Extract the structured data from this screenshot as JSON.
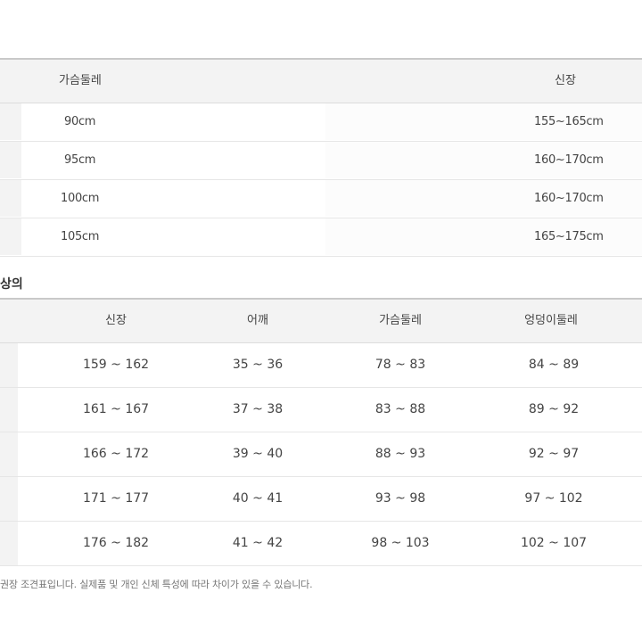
{
  "table1": {
    "headers": [
      "가슴둘레",
      "신장"
    ],
    "rows": [
      [
        "90cm",
        "155~165cm"
      ],
      [
        "95cm",
        "160~170cm"
      ],
      [
        "100cm",
        "160~170cm"
      ],
      [
        "105cm",
        "165~175cm"
      ]
    ]
  },
  "section": {
    "label": "상의"
  },
  "table2": {
    "headers": [
      "신장",
      "어깨",
      "가슴둘레",
      "엉덩이둘레"
    ],
    "rows": [
      [
        "159 ~ 162",
        "35 ~ 36",
        "78 ~ 83",
        "84 ~ 89"
      ],
      [
        "161 ~ 167",
        "37 ~ 38",
        "83 ~ 88",
        "89 ~ 92"
      ],
      [
        "166 ~ 172",
        "39 ~ 40",
        "88 ~ 93",
        "92 ~ 97"
      ],
      [
        "171 ~ 177",
        "40 ~ 41",
        "93 ~ 98",
        "97 ~ 102"
      ],
      [
        "176 ~ 182",
        "41 ~ 42",
        "98 ~ 103",
        "102 ~ 107"
      ]
    ]
  },
  "footnote": "권장 조견표입니다. 실제품 및 개인 신체 특성에 따라 차이가 있을 수 있습니다."
}
